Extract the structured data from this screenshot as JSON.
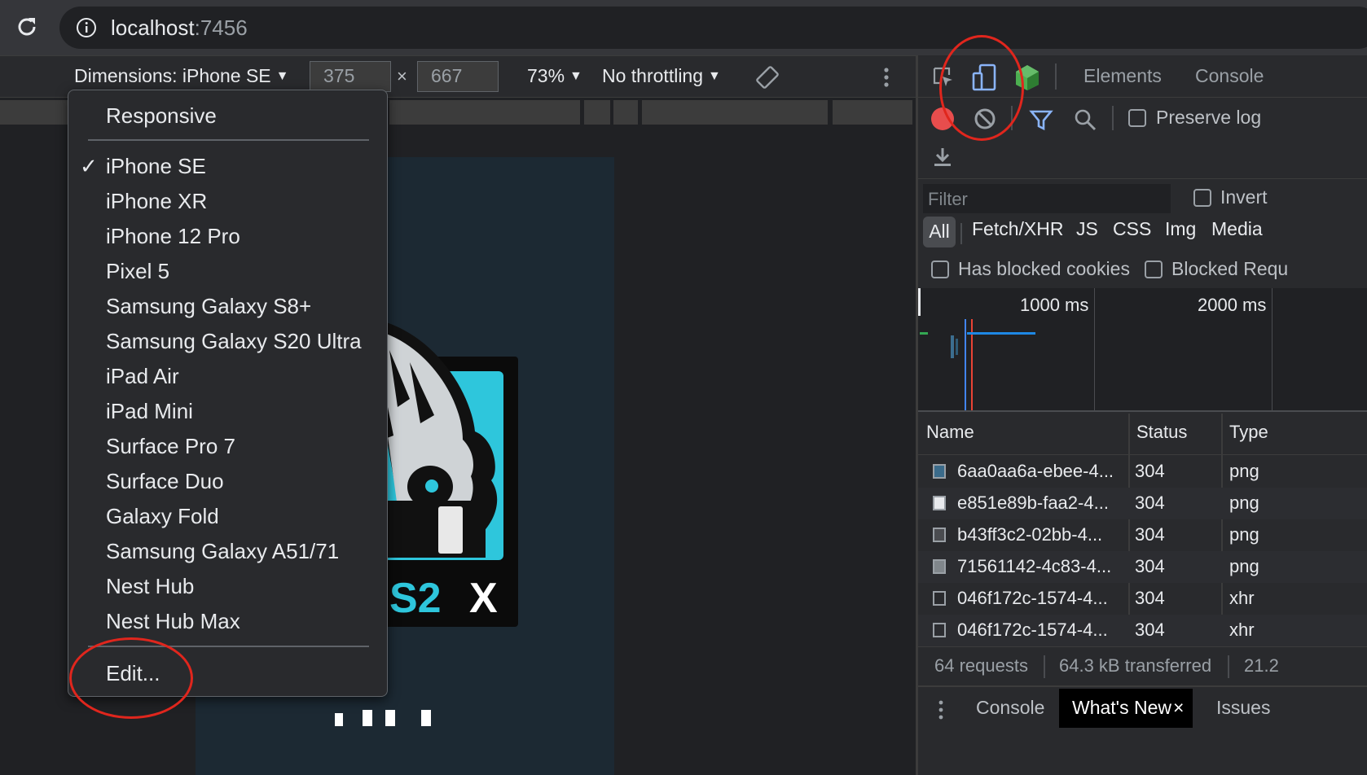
{
  "address_bar": {
    "host": "localhost",
    "port": ":7456"
  },
  "device_toolbar": {
    "dimensions_label": "Dimensions: iPhone SE",
    "width": "375",
    "height": "667",
    "times": "×",
    "zoom": "73%",
    "throttling": "No throttling"
  },
  "device_menu": {
    "responsive": "Responsive",
    "checkmark": "✓",
    "selected": "iPhone SE",
    "devices": [
      "iPhone SE",
      "iPhone XR",
      "iPhone 12 Pro",
      "Pixel 5",
      "Samsung Galaxy S8+",
      "Samsung Galaxy S20 Ultra",
      "iPad Air",
      "iPad Mini",
      "Surface Pro 7",
      "Surface Duo",
      "Galaxy Fold",
      "Samsung Galaxy A51/71",
      "Nest Hub",
      "Nest Hub Max"
    ],
    "edit": "Edit..."
  },
  "devtools": {
    "tabs": [
      "Elements",
      "Console"
    ],
    "network": {
      "preserve_log": "Preserve log",
      "filter_placeholder": "Filter",
      "invert": "Invert",
      "types": [
        "All",
        "Fetch/XHR",
        "JS",
        "CSS",
        "Img",
        "Media"
      ],
      "has_blocked_cookies": "Has blocked cookies",
      "blocked_requests": "Blocked Requ",
      "overview_labels": [
        "1000 ms",
        "2000 ms"
      ],
      "columns": [
        "Name",
        "Status",
        "Type"
      ],
      "rows": [
        {
          "name": "6aa0aa6a-ebee-4...",
          "status": "304",
          "type": "png"
        },
        {
          "name": "e851e89b-faa2-4...",
          "status": "304",
          "type": "png"
        },
        {
          "name": "b43ff3c2-02bb-4...",
          "status": "304",
          "type": "png"
        },
        {
          "name": "71561142-4c83-4...",
          "status": "304",
          "type": "png"
        },
        {
          "name": "046f172c-1574-4...",
          "status": "304",
          "type": "xhr"
        },
        {
          "name": "046f172c-1574-4...",
          "status": "304",
          "type": "xhr"
        }
      ],
      "summary": {
        "requests": "64 requests",
        "transferred": "64.3 kB transferred",
        "resources": "21.2"
      }
    },
    "drawer": {
      "console": "Console",
      "whats_new": "What's New",
      "close": "×",
      "issues": "Issues"
    }
  },
  "colors": {
    "annotation": "#e0261d",
    "record": "#e84d4d",
    "accent_blue": "#8ab4f8"
  }
}
